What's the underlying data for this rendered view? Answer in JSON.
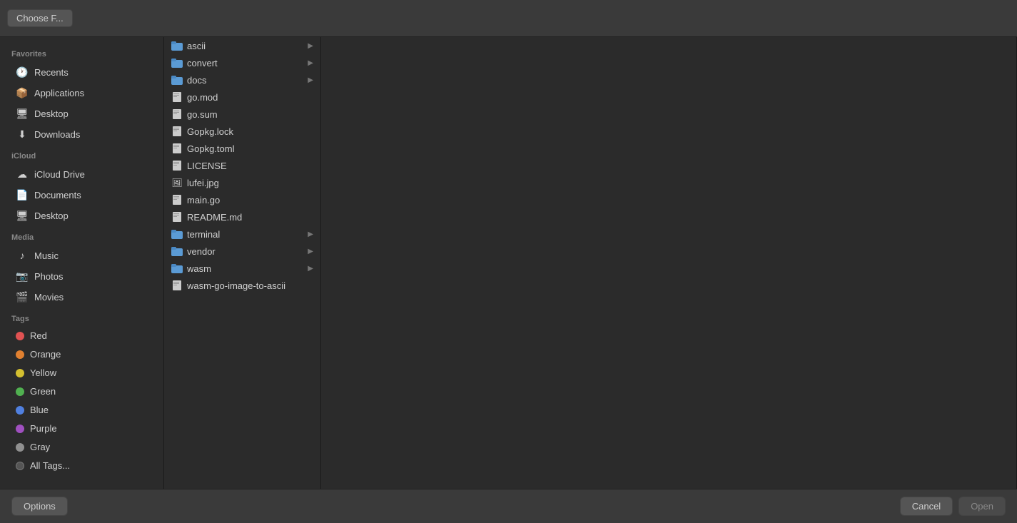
{
  "toolbar": {
    "choose_label": "Choose F..."
  },
  "sidebar": {
    "sections": [
      {
        "label": "Favorites",
        "items": [
          {
            "id": "recents",
            "label": "Recents",
            "icon": "🕐"
          },
          {
            "id": "applications",
            "label": "Applications",
            "icon": "📦"
          },
          {
            "id": "desktop",
            "label": "Desktop",
            "icon": "🖥"
          },
          {
            "id": "downloads",
            "label": "Downloads",
            "icon": "⬇"
          }
        ]
      },
      {
        "label": "iCloud",
        "items": [
          {
            "id": "icloud-drive",
            "label": "iCloud Drive",
            "icon": "☁"
          },
          {
            "id": "documents",
            "label": "Documents",
            "icon": "📄"
          },
          {
            "id": "desktop-icloud",
            "label": "Desktop",
            "icon": "🖥"
          }
        ]
      },
      {
        "label": "Media",
        "items": [
          {
            "id": "music",
            "label": "Music",
            "icon": "♪"
          },
          {
            "id": "photos",
            "label": "Photos",
            "icon": "📷"
          },
          {
            "id": "movies",
            "label": "Movies",
            "icon": "🎬"
          }
        ]
      },
      {
        "label": "Tags",
        "items": [
          {
            "id": "red",
            "label": "Red",
            "color": "#e05252"
          },
          {
            "id": "orange",
            "label": "Orange",
            "color": "#e08030"
          },
          {
            "id": "yellow",
            "label": "Yellow",
            "color": "#d4c030"
          },
          {
            "id": "green",
            "label": "Green",
            "color": "#50b050"
          },
          {
            "id": "blue",
            "label": "Blue",
            "color": "#5080e0"
          },
          {
            "id": "purple",
            "label": "Purple",
            "color": "#a050c0"
          },
          {
            "id": "gray",
            "label": "Gray",
            "color": "#909090"
          },
          {
            "id": "all-tags",
            "label": "All Tags...",
            "color": "#555"
          }
        ]
      }
    ]
  },
  "file_column": {
    "items": [
      {
        "name": "ascii",
        "type": "folder",
        "has_children": true
      },
      {
        "name": "convert",
        "type": "folder",
        "has_children": true
      },
      {
        "name": "docs",
        "type": "folder",
        "has_children": true
      },
      {
        "name": "go.mod",
        "type": "file",
        "has_children": false
      },
      {
        "name": "go.sum",
        "type": "file",
        "has_children": false
      },
      {
        "name": "Gopkg.lock",
        "type": "file",
        "has_children": false
      },
      {
        "name": "Gopkg.toml",
        "type": "file",
        "has_children": false
      },
      {
        "name": "LICENSE",
        "type": "file",
        "has_children": false
      },
      {
        "name": "lufei.jpg",
        "type": "image",
        "has_children": false
      },
      {
        "name": "main.go",
        "type": "file",
        "has_children": false
      },
      {
        "name": "README.md",
        "type": "file",
        "has_children": false
      },
      {
        "name": "terminal",
        "type": "folder",
        "has_children": true
      },
      {
        "name": "vendor",
        "type": "folder",
        "has_children": true
      },
      {
        "name": "wasm",
        "type": "folder",
        "has_children": true
      },
      {
        "name": "wasm-go-image-to-ascii",
        "type": "file",
        "has_children": false
      }
    ]
  },
  "bottom_bar": {
    "options_label": "Options",
    "cancel_label": "Cancel",
    "open_label": "Open"
  }
}
